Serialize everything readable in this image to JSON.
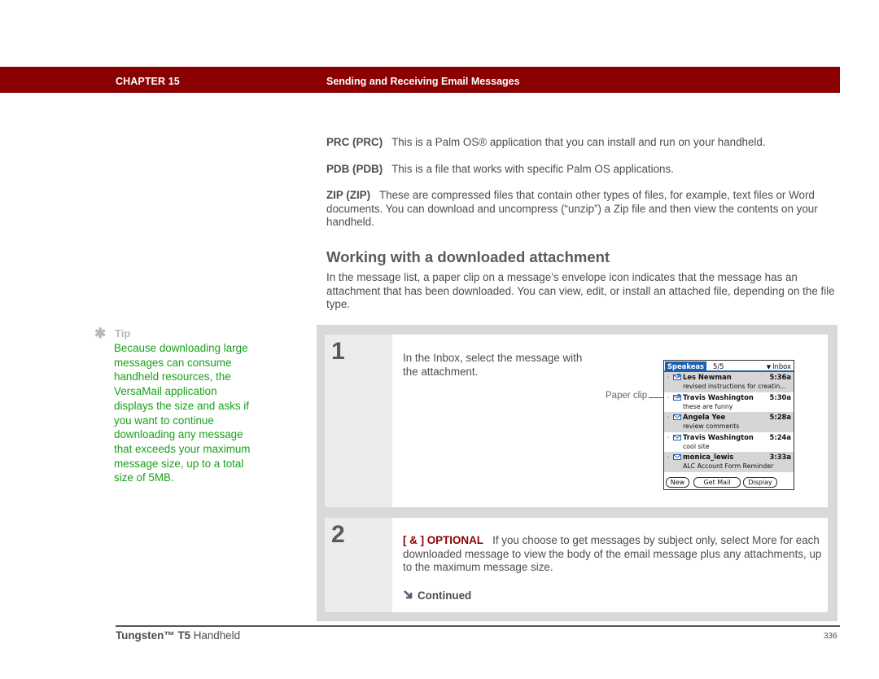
{
  "header": {
    "chapter_label": "CHAPTER 15",
    "chapter_title": "Sending and Receiving Email Messages",
    "bar_color": "#8b0000"
  },
  "definitions": [
    {
      "term": "PRC (PRC)",
      "text": "This is a Palm OS® application that you can install and run on your handheld."
    },
    {
      "term": "PDB (PDB)",
      "text": "This is a file that works with specific Palm OS applications."
    },
    {
      "term": "ZIP (ZIP)",
      "text": "These are compressed files that contain other types of files, for example, text files or Word documents. You can download and uncompress (“unzip”) a Zip file and then view the contents on your handheld."
    }
  ],
  "section": {
    "heading": "Working with a downloaded attachment",
    "intro": "In the message list, a paper clip on a message’s envelope icon indicates that the message has an attachment that has been downloaded. You can view, edit, or install an attached file, depending on the file type."
  },
  "tip": {
    "icon": "asterisk-icon",
    "title": "Tip",
    "body": "Because downloading large messages can consume handheld resources, the VersaMail application displays the size and asks if you want to continue downloading any message that exceeds your maximum message size, up to a total size of 5MB.",
    "color": "#1aa01a"
  },
  "steps": [
    {
      "number": "1",
      "text": "In the Inbox, select the message with the attachment.",
      "callout": "Paper clip"
    },
    {
      "number": "2",
      "optional_label": "[ & ]  OPTIONAL",
      "text": "If you choose to get messages by subject only, select More for each downloaded message to view the body of the email message plus any attachments, up to the maximum message size.",
      "continued_label": "Continued"
    }
  ],
  "palm_screen": {
    "account": "Speakeas",
    "count": "5/5",
    "folder": "Inbox",
    "messages": [
      {
        "sender": "Les Newman",
        "time": "5:36a",
        "subject": "revised instructions for creatin...",
        "attachment": true,
        "shaded": true
      },
      {
        "sender": "Travis Washington",
        "time": "5:30a",
        "subject": "these are funny",
        "attachment": true,
        "shaded": false
      },
      {
        "sender": "Angela Yee",
        "time": "5:28a",
        "subject": "review comments",
        "attachment": false,
        "shaded": true
      },
      {
        "sender": "Travis Washington",
        "time": "5:24a",
        "subject": "cool site",
        "attachment": false,
        "shaded": false
      },
      {
        "sender": "monica_lewis",
        "time": "3:33a",
        "subject": "ALC Account Form Reminder",
        "attachment": false,
        "shaded": true
      }
    ],
    "buttons": [
      "New",
      "Get Mail",
      "Display"
    ]
  },
  "footer": {
    "product_bold": "Tungsten™ T5",
    "product_rest": " Handheld",
    "page_number": "336"
  }
}
